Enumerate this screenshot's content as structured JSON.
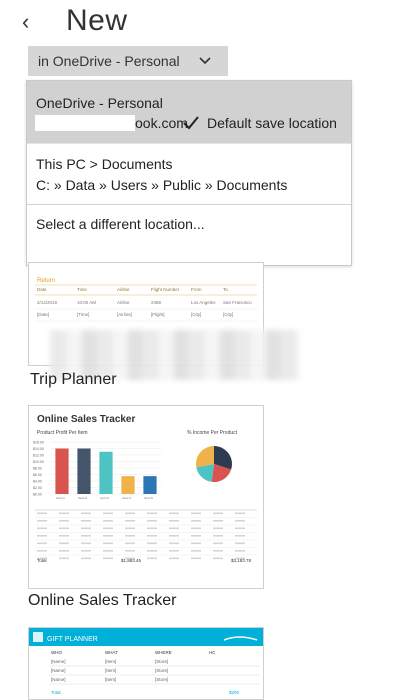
{
  "header": {
    "title": "New",
    "back_glyph": "‹"
  },
  "location_select": {
    "label": "in OneDrive - Personal"
  },
  "dropdown": {
    "option1": {
      "name": "OneDrive - Personal",
      "email_suffix": "ook.com",
      "default_label": "Default save location"
    },
    "option2": {
      "line1": "This PC > Documents",
      "line2": "C: » Data » Users » Public » Documents"
    },
    "option3": {
      "label": "Select a different location..."
    }
  },
  "templates": [
    {
      "caption": "Trip Planner",
      "section": "Return",
      "columns": [
        "Date",
        "Time",
        "Airline",
        "Flight Number",
        "From",
        "To"
      ],
      "row": [
        "2/14/2019",
        "10:00 AM",
        "Airline",
        "2468",
        "Los Angeles",
        "San Francisco"
      ],
      "placeholders": [
        "[Date]",
        "[Time]",
        "[Airline]",
        "[Flight]",
        "[City]",
        "[City]"
      ]
    },
    {
      "caption": "Online Sales Tracker",
      "title": "Online Sales Tracker",
      "bar_title": "Product Profit Per Item",
      "pie_title": "% Income Per Product",
      "y_ticks": [
        "$16.00",
        "$14.00",
        "$12.00",
        "$10.00",
        "$8.00",
        "$6.00",
        "$4.00",
        "$2.00",
        "$0.00"
      ],
      "bar_labels": [
        "Item 1",
        "Item 2",
        "Item 3",
        "Item 4",
        "Item 5"
      ],
      "bar_values": [
        14.0,
        14.0,
        13.0,
        5.5,
        5.5
      ],
      "bar_colors": [
        "#d9534f",
        "#44546a",
        "#4ec3c3",
        "#f0b24a",
        "#2e75b6"
      ],
      "pie_values": [
        30,
        22,
        20,
        28
      ],
      "pie_colors": [
        "#2f3b52",
        "#d9534f",
        "#4ec3c3",
        "#f0b24a"
      ],
      "total_label": "Total",
      "total_value1": "$1,883.45",
      "total_value2": "$3,183.78"
    },
    {
      "caption": "",
      "title": "GIFT PLANNER",
      "columns": [
        "WHO",
        "WHAT",
        "WHERE",
        "HC"
      ],
      "rows": [
        [
          "[Name]",
          "[Item]",
          "[Store]"
        ],
        [
          "[Name]",
          "[Item]",
          "[Store]"
        ],
        [
          "[Name]",
          "[Item]",
          "[Store]"
        ]
      ],
      "total_label": "Total",
      "total_value": "$200"
    }
  ],
  "colors": {
    "accent_teal": "#00b0d8",
    "selected_bg": "#d1d1d1",
    "select_bg": "#d6d6d6"
  }
}
